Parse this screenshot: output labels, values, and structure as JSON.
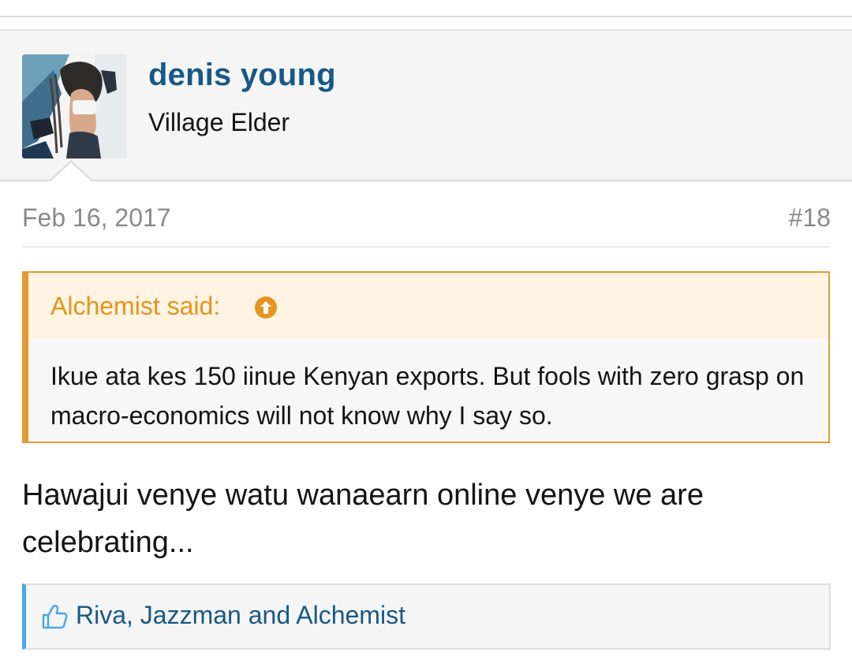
{
  "post": {
    "user": {
      "name": "denis young",
      "title": "Village Elder",
      "avatar_icon": "avatar-photo"
    },
    "date": "Feb 16, 2017",
    "number": "#18",
    "quote": {
      "author_label": "Alchemist said:",
      "icon": "arrow-up-circle-icon",
      "text": "Ikue ata kes 150 iinue Kenyan exports. But fools with zero grasp on macro-economics will not know why I say so."
    },
    "message": "Hawajui venye watu wanaearn online venye we are celebrating...",
    "likes": {
      "icon": "thumbs-up-icon",
      "text": "Riva, Jazzman and Alchemist"
    }
  },
  "colors": {
    "username": "#185886",
    "quote_accent": "#e39b31",
    "likes_accent": "#47a7eb"
  }
}
